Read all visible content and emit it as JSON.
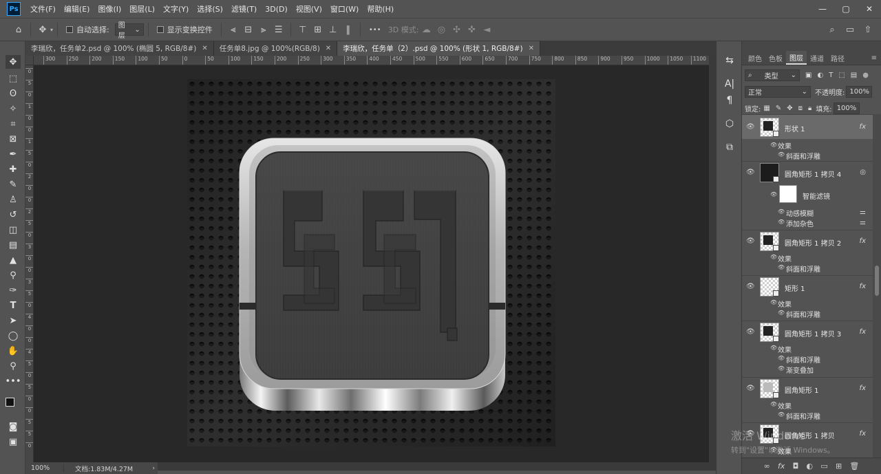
{
  "app": {
    "logo": "Ps"
  },
  "menu": [
    "文件(F)",
    "编辑(E)",
    "图像(I)",
    "图层(L)",
    "文字(Y)",
    "选择(S)",
    "滤镜(T)",
    "3D(D)",
    "视图(V)",
    "窗口(W)",
    "帮助(H)"
  ],
  "options": {
    "auto_select_label": "自动选择:",
    "auto_select_value": "图层",
    "show_transform_label": "显示变换控件",
    "mode_3d_label": "3D 模式:",
    "more": "•••"
  },
  "tabs": [
    {
      "label": "李瑞欣，任务单2.psd @ 100% (椭圆 5, RGB/8#)",
      "active": false
    },
    {
      "label": "任务单8.jpg @ 100%(RGB/8)",
      "active": false
    },
    {
      "label": "李瑞欣，任务单（2）.psd @ 100% (形状 1, RGB/8#)",
      "active": true
    }
  ],
  "ruler_h": [
    "300",
    "250",
    "200",
    "150",
    "100",
    "50",
    "0",
    "50",
    "100",
    "150",
    "200",
    "250",
    "300",
    "350",
    "400",
    "450",
    "500",
    "550",
    "600",
    "650",
    "700",
    "750",
    "800",
    "850",
    "900",
    "950",
    "1000",
    "1050",
    "1100"
  ],
  "ruler_v": [
    "0",
    "5",
    "0",
    "1",
    "0",
    "0",
    "1",
    "5",
    "0",
    "2",
    "0",
    "0",
    "2",
    "5",
    "0",
    "3",
    "0",
    "0",
    "3",
    "5",
    "0",
    "4",
    "0",
    "0",
    "4",
    "5",
    "0",
    "5",
    "0",
    "0",
    "5",
    "5",
    "0"
  ],
  "status": {
    "zoom": "100%",
    "doc": "文档:1.83M/4.27M"
  },
  "panel": {
    "tabs": [
      "颜色",
      "色板",
      "图层",
      "通道",
      "路径"
    ],
    "active_tab": "图层",
    "filter_kind": "类型",
    "blend_mode": "正常",
    "opacity_label": "不透明度:",
    "opacity_value": "100%",
    "lock_label": "锁定:",
    "fill_label": "填充:",
    "fill_value": "100%"
  },
  "layers": [
    {
      "name": "形状 1",
      "fx": true,
      "subs": [
        "效果",
        "斜面和浮雕"
      ]
    },
    {
      "name": "圆角矩形 1 拷贝 4",
      "fx": false,
      "smart": "智能滤镜",
      "subs": [
        "动感模糊",
        "添加杂色"
      ]
    },
    {
      "name": "圆角矩形 1 拷贝 2",
      "fx": true,
      "subs": [
        "效果",
        "斜面和浮雕"
      ]
    },
    {
      "name": "矩形 1",
      "fx": true,
      "subs": [
        "效果",
        "斜面和浮雕"
      ]
    },
    {
      "name": "圆角矩形 1 拷贝 3",
      "fx": true,
      "subs": [
        "效果",
        "斜面和浮雕",
        "渐变叠加"
      ]
    },
    {
      "name": "圆角矩形 1",
      "fx": true,
      "subs": [
        "效果",
        "斜面和浮雕"
      ]
    },
    {
      "name": "圆角矩形 1 拷贝",
      "fx": true,
      "subs": [
        "效果"
      ]
    }
  ],
  "watermark": {
    "line1": "激活 Windows",
    "line2": "转到\"设置\"以激活 Windows。"
  },
  "colors": {
    "ui_bg": "#535353",
    "canvas_bg": "#282828",
    "accent": "#31a8ff",
    "panel_dark": "#474747"
  }
}
